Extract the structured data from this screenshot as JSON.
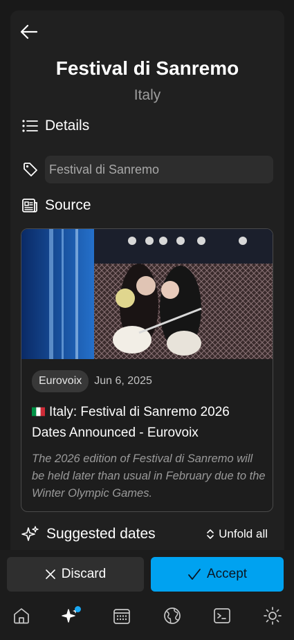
{
  "header": {
    "title": "Festival di Sanremo",
    "subtitle": "Italy"
  },
  "details": {
    "label": "Details",
    "tag_value": "Festival di Sanremo"
  },
  "source": {
    "label": "Source",
    "card": {
      "chip": "Eurovoix",
      "date": "Jun 6, 2025",
      "title": "Italy: Festival di Sanremo 2026 Dates Announced - Eurovoix",
      "description": "The 2026 edition of Festival di Sanremo will be held later than usual in February due to the Winter Olympic Games."
    }
  },
  "suggested": {
    "label": "Suggested dates",
    "unfold_label": "Unfold all"
  },
  "actions": {
    "discard_label": "Discard",
    "accept_label": "Accept"
  },
  "nav": {
    "items": [
      "home-icon",
      "sparkles-icon",
      "calendar-icon",
      "globe-icon",
      "terminal-icon",
      "sun-icon"
    ],
    "active": "sparkles-icon"
  },
  "colors": {
    "background": "#191919",
    "panel": "#202020",
    "accent": "#00a2f0",
    "muted_text": "#9e9e9e"
  }
}
